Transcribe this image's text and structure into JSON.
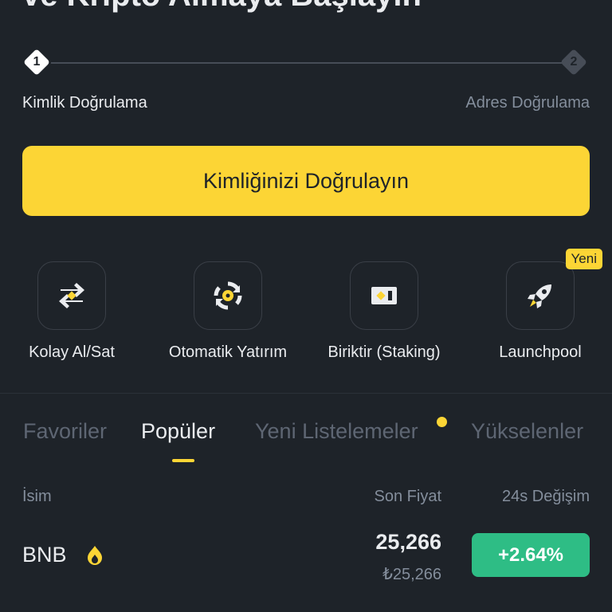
{
  "header": {
    "title": "ve Kripto Almaya Başlayın"
  },
  "stepper": {
    "steps": [
      {
        "number": "1",
        "label": "Kimlik Doğrulama",
        "state": "active"
      },
      {
        "number": "2",
        "label": "Adres Doğrulama",
        "state": "inactive"
      }
    ]
  },
  "cta": {
    "label": "Kimliğinizi Doğrulayın"
  },
  "quick_actions": [
    {
      "label": "Kolay Al/Sat",
      "icon": "swap-icon"
    },
    {
      "label": "Otomatik Yatırım",
      "icon": "auto-invest-icon"
    },
    {
      "label": "Biriktir (Staking)",
      "icon": "staking-icon"
    },
    {
      "label": "Launchpool",
      "icon": "rocket-icon",
      "badge": "Yeni"
    }
  ],
  "tabs": [
    {
      "label": "Favoriler",
      "active": false
    },
    {
      "label": "Popüler",
      "active": true
    },
    {
      "label": "Yeni Listelemeler",
      "active": false,
      "dot": true
    },
    {
      "label": "Yükselenler",
      "active": false
    }
  ],
  "table": {
    "headers": {
      "name": "İsim",
      "price": "Son Fiyat",
      "change": "24s Değişim"
    },
    "rows": [
      {
        "coin": "BNB",
        "price": "25,266",
        "price_local": "₺25,266",
        "change": "+2.64%"
      }
    ]
  },
  "colors": {
    "accent": "#fcd535",
    "positive": "#2ebd85",
    "background": "#1e2329"
  }
}
